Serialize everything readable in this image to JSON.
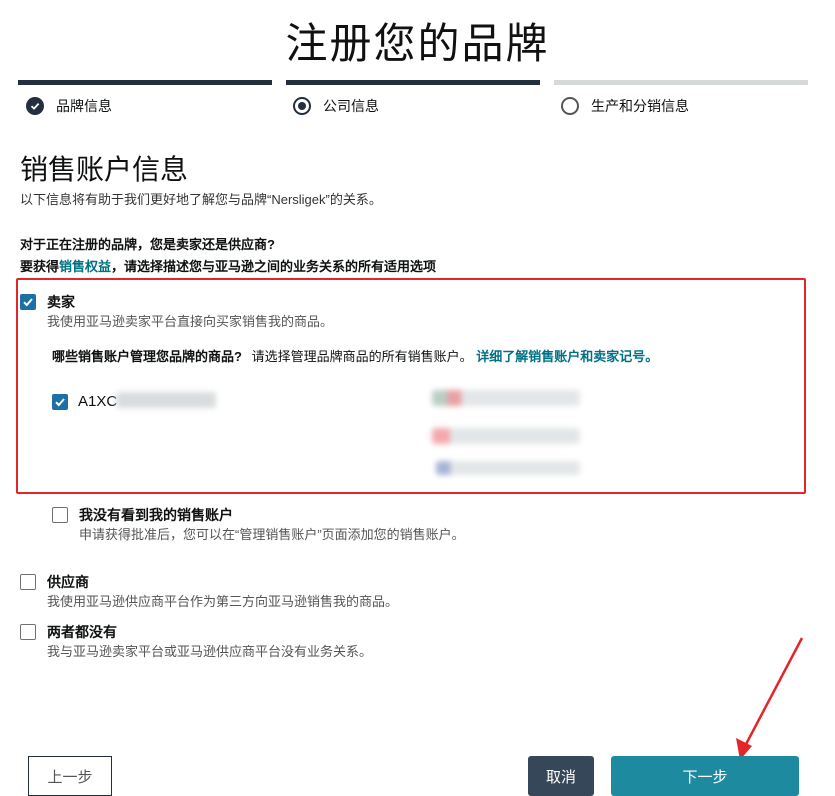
{
  "page": {
    "title": "注册您的品牌"
  },
  "steps": [
    {
      "label": "品牌信息",
      "state": "done"
    },
    {
      "label": "公司信息",
      "state": "active"
    },
    {
      "label": "生产和分销信息",
      "state": "todo"
    }
  ],
  "section": {
    "heading": "销售账户信息",
    "intro": "以下信息将有助于我们更好地了解您与品牌“Nersligek”的关系。",
    "question": "对于正在注册的品牌，您是卖家还是供应商?",
    "instruction_pre": "要获得",
    "instruction_link": "销售权益",
    "instruction_post": "，请选择描述您与亚马逊之间的业务关系的所有适用选项"
  },
  "seller": {
    "checked": true,
    "label": "卖家",
    "desc": "我使用亚马逊卖家平台直接向买家销售我的商品。",
    "accounts_question": "哪些销售账户管理您品牌的商品?",
    "accounts_hint": "请选择管理品牌商品的所有销售账户。",
    "accounts_link": "详细了解销售账户和卖家记号。",
    "account_id": "A1XC",
    "account_checked": true
  },
  "not_seen": {
    "checked": false,
    "label": "我没有看到我的销售账户",
    "desc": "申请获得批准后，您可以在“管理销售账户”页面添加您的销售账户。"
  },
  "vendor": {
    "checked": false,
    "label": "供应商",
    "desc": "我使用亚马逊供应商平台作为第三方向亚马逊销售我的商品。"
  },
  "neither": {
    "checked": false,
    "label": "两者都没有",
    "desc": "我与亚马逊卖家平台或亚马逊供应商平台没有业务关系。"
  },
  "buttons": {
    "prev": "上一步",
    "cancel": "取消",
    "next": "下一步"
  },
  "colors": {
    "accent": "#007185",
    "highlight": "#e3262b",
    "progress": "#232f3e",
    "checkbox": "#1d6fa5"
  }
}
